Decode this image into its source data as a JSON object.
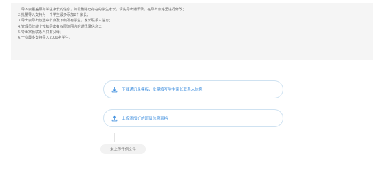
{
  "instructions": {
    "lines": [
      "1.导入会覆盖原有学生家长的信息，如需删除已存在的学生家长，请先导出通讯录，在导出表格里进行修改；",
      "2.批量导入支持为一个学生最多添加2个家长；",
      "3.导出会导出该选中节点及下级所有学生，家长联系人信息；",
      "4.管理员仅能上传和导出有权限范围内的通讯录信息；；",
      "5.导出家长联系人只有父母；",
      "6.一次最多支持导入2000名学生。"
    ]
  },
  "actions": {
    "download_label": "下载通讯录模板，批量填写学生家长联系人信息",
    "upload_label": "上传添加好的班级信息表格"
  },
  "status": {
    "text": "未上传任何文件"
  },
  "colors": {
    "accent": "#3c8dde",
    "button_border": "#cfe2f1",
    "notice_bg": "#f5f5f5"
  },
  "icons": {
    "download": "download-icon",
    "upload": "upload-icon"
  }
}
